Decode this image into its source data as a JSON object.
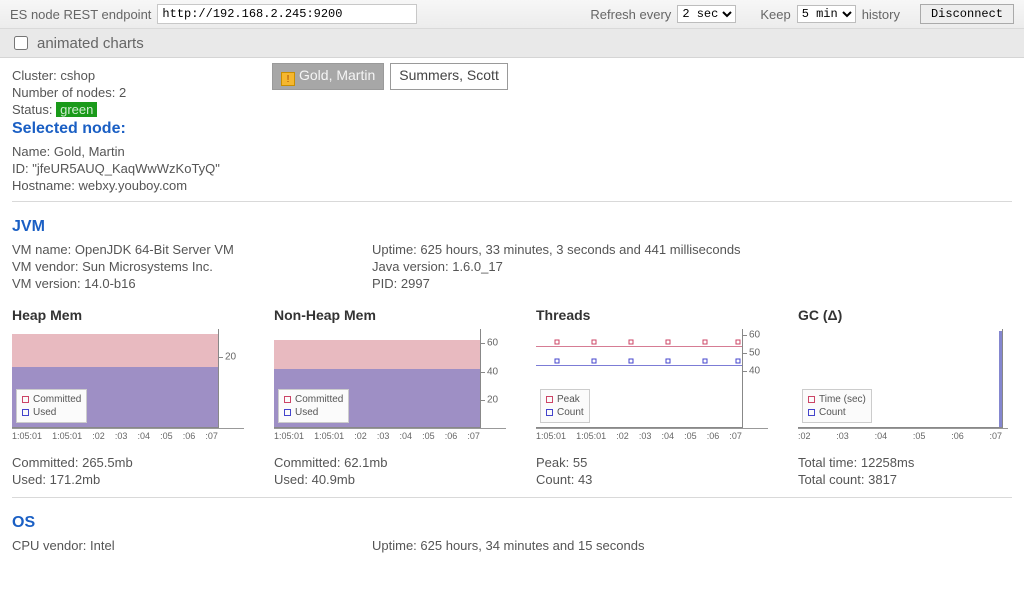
{
  "topbar": {
    "endpoint_label": "ES node REST endpoint",
    "endpoint_value": "http://192.168.2.245:9200",
    "refresh_label": "Refresh every",
    "refresh_value": "2 sec",
    "keep_label": "Keep",
    "keep_value": "5 min",
    "history_label": "history",
    "disconnect": "Disconnect"
  },
  "animbar": {
    "label": "animated charts",
    "checked": false
  },
  "cluster": {
    "cluster_label": "Cluster:",
    "cluster_name": "cshop",
    "num_label": "Number of nodes:",
    "num_value": "2",
    "status_label": "Status:",
    "status_value": "green"
  },
  "nodes": [
    {
      "name": "Gold, Martin",
      "selected": true,
      "warn": true
    },
    {
      "name": "Summers, Scott",
      "selected": false,
      "warn": false
    }
  ],
  "selected": {
    "heading": "Selected node:",
    "name_label": "Name:",
    "name": "Gold, Martin",
    "id_label": "ID:",
    "id": "\"jfeUR5AUQ_KaqWwWzKoTyQ\"",
    "host_label": "Hostname:",
    "host": "webxy.youboy.com"
  },
  "jvm": {
    "heading": "JVM",
    "left": {
      "vm_name_l": "VM name:",
      "vm_name": "OpenJDK 64-Bit Server VM",
      "vm_vendor_l": "VM vendor:",
      "vm_vendor": "Sun Microsystems Inc.",
      "vm_version_l": "VM version:",
      "vm_version": "14.0-b16"
    },
    "right": {
      "uptime_l": "Uptime:",
      "uptime": "625 hours, 33 minutes, 3 seconds and 441 milliseconds",
      "java_l": "Java version:",
      "java": "1.6.0_17",
      "pid_l": "PID:",
      "pid": "2997"
    }
  },
  "legends": {
    "committed": "Committed",
    "used": "Used",
    "peak": "Peak",
    "count": "Count",
    "time": "Time (sec)"
  },
  "chart_data": [
    {
      "type": "area",
      "title": "Heap Mem",
      "x_ticks": [
        "1:05:01",
        "1:05:01",
        ":02",
        ":03",
        ":04",
        ":05",
        ":06",
        ":07"
      ],
      "ylim": [
        0,
        28
      ],
      "y_ticks": [
        20
      ],
      "series": [
        {
          "name": "Committed",
          "value_pct": 95,
          "color": "red"
        },
        {
          "name": "Used",
          "value_pct": 61,
          "color": "blue"
        }
      ],
      "stats": {
        "Committed": "265.5mb",
        "Used": "171.2mb"
      }
    },
    {
      "type": "area",
      "title": "Non-Heap Mem",
      "x_ticks": [
        "1:05:01",
        "1:05:01",
        ":02",
        ":03",
        ":04",
        ":05",
        ":06",
        ":07"
      ],
      "ylim": [
        0,
        70
      ],
      "y_ticks": [
        20,
        40,
        60
      ],
      "series": [
        {
          "name": "Committed",
          "value_pct": 89,
          "color": "red"
        },
        {
          "name": "Used",
          "value_pct": 59,
          "color": "blue"
        }
      ],
      "stats": {
        "Committed": "62.1mb",
        "Used": "40.9mb"
      }
    },
    {
      "type": "line",
      "title": "Threads",
      "x_ticks": [
        "1:05:01",
        "1:05:01",
        ":02",
        ":03",
        ":04",
        ":05",
        ":06",
        ":07"
      ],
      "ylim": [
        0,
        62
      ],
      "y_ticks": [
        40,
        50,
        60
      ],
      "series": [
        {
          "name": "Peak",
          "value": 55,
          "pct": 82,
          "color": "red"
        },
        {
          "name": "Count",
          "value": 43,
          "pct": 62,
          "color": "blue"
        }
      ],
      "stats": {
        "Peak": "55",
        "Count": "43"
      }
    },
    {
      "type": "bar",
      "title": "GC (Δ)",
      "x_ticks": [
        ":02",
        ":03",
        ":04",
        ":05",
        ":06",
        ":07"
      ],
      "ylim": [
        0,
        1
      ],
      "y_ticks": [],
      "series": [
        {
          "name": "Time (sec)",
          "color": "red"
        },
        {
          "name": "Count",
          "color": "blue"
        }
      ],
      "bar": {
        "pct": 98
      },
      "stats": {
        "Total time": "12258ms",
        "Total count": "3817"
      }
    }
  ],
  "os": {
    "heading": "OS",
    "cpu_vendor_l": "CPU vendor:",
    "cpu_vendor": "Intel",
    "uptime_l": "Uptime:",
    "uptime": "625 hours, 34 minutes and 15 seconds"
  }
}
